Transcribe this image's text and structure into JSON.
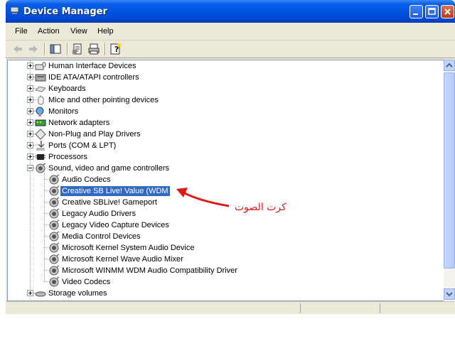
{
  "window": {
    "title": "Device Manager"
  },
  "menu": [
    "File",
    "Action",
    "View",
    "Help"
  ],
  "tree": [
    {
      "label": "Human Interface Devices",
      "icon": "keyboard-mouse-icon",
      "level": 1,
      "expander": "plus"
    },
    {
      "label": "IDE ATA/ATAPI controllers",
      "icon": "disk-controller-icon",
      "level": 1,
      "expander": "plus"
    },
    {
      "label": "Keyboards",
      "icon": "keyboard-icon",
      "level": 1,
      "expander": "plus"
    },
    {
      "label": "Mice and other pointing devices",
      "icon": "mouse-icon",
      "level": 1,
      "expander": "plus"
    },
    {
      "label": "Monitors",
      "icon": "monitor-icon",
      "level": 1,
      "expander": "plus"
    },
    {
      "label": "Network adapters",
      "icon": "network-card-icon",
      "level": 1,
      "expander": "plus"
    },
    {
      "label": "Non-Plug and Play Drivers",
      "icon": "diamond-driver-icon",
      "level": 1,
      "expander": "plus"
    },
    {
      "label": "Ports (COM & LPT)",
      "icon": "port-icon",
      "level": 1,
      "expander": "plus"
    },
    {
      "label": "Processors",
      "icon": "processor-icon",
      "level": 1,
      "expander": "plus"
    },
    {
      "label": "Sound, video and game controllers",
      "icon": "speaker-icon",
      "level": 1,
      "expander": "minus"
    },
    {
      "label": "Audio Codecs",
      "icon": "speaker-icon",
      "level": 2
    },
    {
      "label": "Creative SB Live! Value (WDM",
      "icon": "speaker-icon",
      "level": 2,
      "selected": true
    },
    {
      "label": "Creative SBLive! Gameport",
      "icon": "speaker-icon",
      "level": 2
    },
    {
      "label": "Legacy Audio Drivers",
      "icon": "speaker-icon",
      "level": 2
    },
    {
      "label": "Legacy Video Capture Devices",
      "icon": "speaker-icon",
      "level": 2
    },
    {
      "label": "Media Control Devices",
      "icon": "speaker-icon",
      "level": 2
    },
    {
      "label": "Microsoft Kernel System Audio Device",
      "icon": "speaker-icon",
      "level": 2
    },
    {
      "label": "Microsoft Kernel Wave Audio Mixer",
      "icon": "speaker-icon",
      "level": 2
    },
    {
      "label": "Microsoft WINMM WDM Audio Compatibility Driver",
      "icon": "speaker-icon",
      "level": 2
    },
    {
      "label": "Video Codecs",
      "icon": "speaker-icon",
      "level": 2
    },
    {
      "label": "Storage volumes",
      "icon": "storage-icon",
      "level": 1,
      "expander": "plus"
    }
  ],
  "annotation": {
    "text": "كرت الصوت",
    "color": "#e01818"
  },
  "colors": {
    "titlebar": "#0053e1",
    "selection": "#316ac5",
    "annotation": "#e01818"
  }
}
